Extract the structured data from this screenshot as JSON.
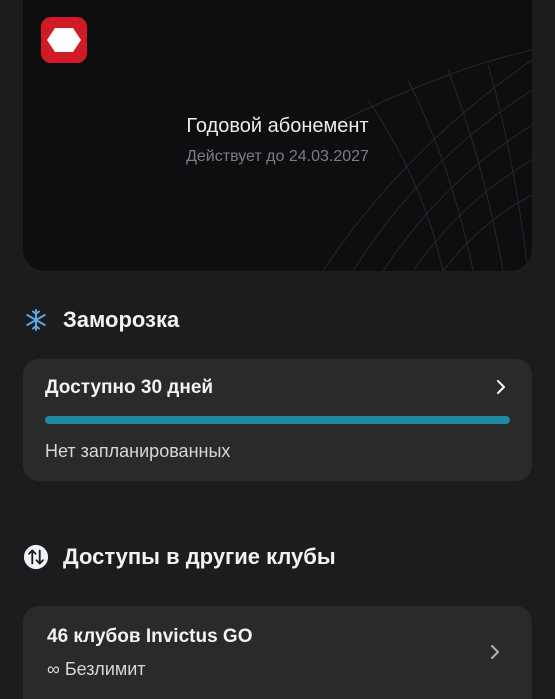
{
  "membership": {
    "title": "Годовой абонемент",
    "valid_until": "Действует до 24.03.2027",
    "logo": "invictus-hexagon-logo",
    "brand_color": "#d01b24"
  },
  "freeze": {
    "icon": "snowflake-icon",
    "section_title": "Заморозка",
    "available": "Доступно 30 дней",
    "available_fraction": 1.0,
    "planned": "Нет запланированных",
    "progress_color": "#1f8aa0"
  },
  "club_access": {
    "icon": "swap-arrows-icon",
    "section_title": "Доступы в другие клубы",
    "clubs": "46 клубов Invictus GO",
    "limit": "∞ Безлимит"
  }
}
